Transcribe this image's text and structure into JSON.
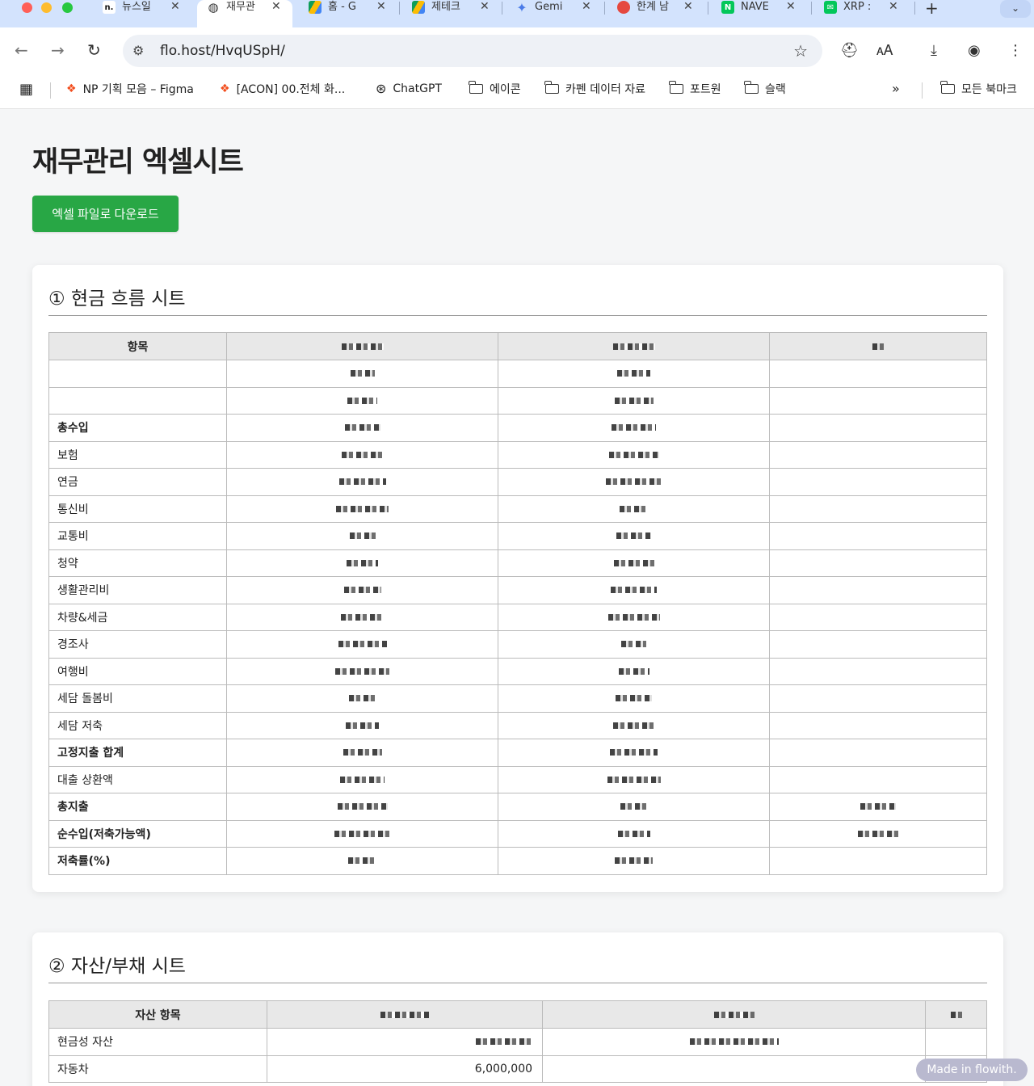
{
  "browser": {
    "tabs": [
      {
        "title": "뉴스일",
        "icon": "flowith-icon",
        "color": "#ffffff"
      },
      {
        "title": "재무관",
        "icon": "globe-icon",
        "color": "#ffffff"
      },
      {
        "title": "홈 - G",
        "icon": "google-drive-icon",
        "color": "#ffffff"
      },
      {
        "title": "제테크",
        "icon": "google-drive-icon",
        "color": "#ffffff"
      },
      {
        "title": "Gemi",
        "icon": "gemini-icon",
        "color": "#ffffff"
      },
      {
        "title": "한계 남",
        "icon": "red-circle-icon",
        "color": "#e5483f"
      },
      {
        "title": "NAVE",
        "icon": "naver-icon",
        "color": "#03c75a"
      },
      {
        "title": "XRP :",
        "icon": "naver-mail-icon",
        "color": "#03c75a"
      }
    ],
    "address": "flo.host/HvqUSpH/",
    "bookmarks": [
      {
        "label": "NP 기획 모음 – Figma",
        "icon": "figma-icon"
      },
      {
        "label": "[ACON] 00.전체 화...",
        "icon": "figma-icon"
      },
      {
        "label": "ChatGPT",
        "icon": "chatgpt-icon"
      },
      {
        "label": "에이콘",
        "icon": "folder-icon"
      },
      {
        "label": "카펜 데이터 자료",
        "icon": "folder-icon"
      },
      {
        "label": "포트원",
        "icon": "folder-icon"
      },
      {
        "label": "슬랙",
        "icon": "folder-icon"
      }
    ],
    "all_bookmarks": "모든 북마크"
  },
  "page": {
    "title": "재무관리 엑셀시트",
    "download_label": "엑셀 파일로 다운로드",
    "accent": "#28a745"
  },
  "cashflow": {
    "heading": "① 현금 흐름 시트",
    "header_item": "항목",
    "rows": [
      {
        "label": "",
        "bold": false
      },
      {
        "label": "",
        "bold": false
      },
      {
        "label": "총수입",
        "bold": true
      },
      {
        "label": "보험",
        "bold": false
      },
      {
        "label": "연금",
        "bold": false
      },
      {
        "label": "통신비",
        "bold": false
      },
      {
        "label": "교통비",
        "bold": false
      },
      {
        "label": "청약",
        "bold": false
      },
      {
        "label": "생활관리비",
        "bold": false
      },
      {
        "label": "차량&세금",
        "bold": false
      },
      {
        "label": "경조사",
        "bold": false
      },
      {
        "label": "여행비",
        "bold": false
      },
      {
        "label": "세담 돌봄비",
        "bold": false
      },
      {
        "label": "세담 저축",
        "bold": false
      },
      {
        "label": "고정지출 합계",
        "bold": true
      },
      {
        "label": "대출 상환액",
        "bold": false
      },
      {
        "label": "총지출",
        "bold": true
      },
      {
        "label": "순수입(저축가능액)",
        "bold": true
      },
      {
        "label": "저축률(%)",
        "bold": true
      }
    ]
  },
  "assets": {
    "heading": "② 자산/부채 시트",
    "header_item": "자산 항목",
    "rows": [
      {
        "label": "현금성 자산",
        "value": ""
      },
      {
        "label": "자동차",
        "value": "6,000,000"
      }
    ]
  },
  "badge": "Made in flowith."
}
